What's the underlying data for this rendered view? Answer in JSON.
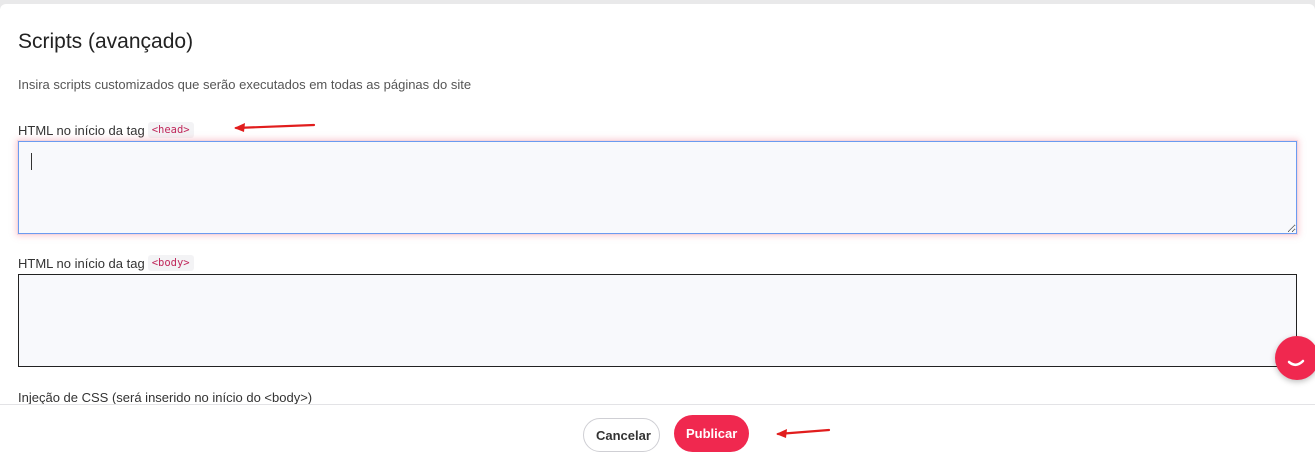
{
  "header": {
    "title": "Scripts (avançado)",
    "description": "Insira scripts customizados que serão executados em todas as páginas do site"
  },
  "fields": {
    "head": {
      "label": "HTML no início da tag",
      "tag": "<head>",
      "value": ""
    },
    "body": {
      "label": "HTML no início da tag",
      "tag": "<body>",
      "value": ""
    },
    "css": {
      "label": "Injeção de CSS (será inserido no início do <body>)"
    }
  },
  "footer": {
    "cancel_label": "Cancelar",
    "publish_label": "Publicar"
  },
  "colors": {
    "accent": "#f0284f",
    "annotation": "#e11d1d",
    "focus_border": "#6b9bf0"
  },
  "icons": {
    "chat": "chat-bubble-icon",
    "annotation_arrow": "arrow-left-icon"
  }
}
